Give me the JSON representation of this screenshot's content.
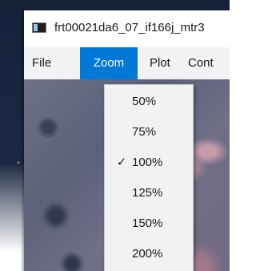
{
  "window": {
    "title": "frt00021da6_07_if166j_mtr3"
  },
  "menubar": {
    "items": [
      {
        "label": "File"
      },
      {
        "label": "Zoom"
      },
      {
        "label": "Plot"
      },
      {
        "label": "Cont"
      }
    ],
    "active": "Zoom"
  },
  "zoom_menu": {
    "items": [
      {
        "label": "50%",
        "check": ""
      },
      {
        "label": "75%",
        "check": ""
      },
      {
        "label": "100%",
        "check": "✓"
      },
      {
        "label": "125%",
        "check": ""
      },
      {
        "label": "150%",
        "check": ""
      },
      {
        "label": "200%",
        "check": ""
      }
    ],
    "selected": "100%"
  },
  "image": {
    "cursor_mark": "+"
  },
  "colors": {
    "menu_highlight": "#0078d7",
    "menu_background": "#f2f2f2"
  }
}
